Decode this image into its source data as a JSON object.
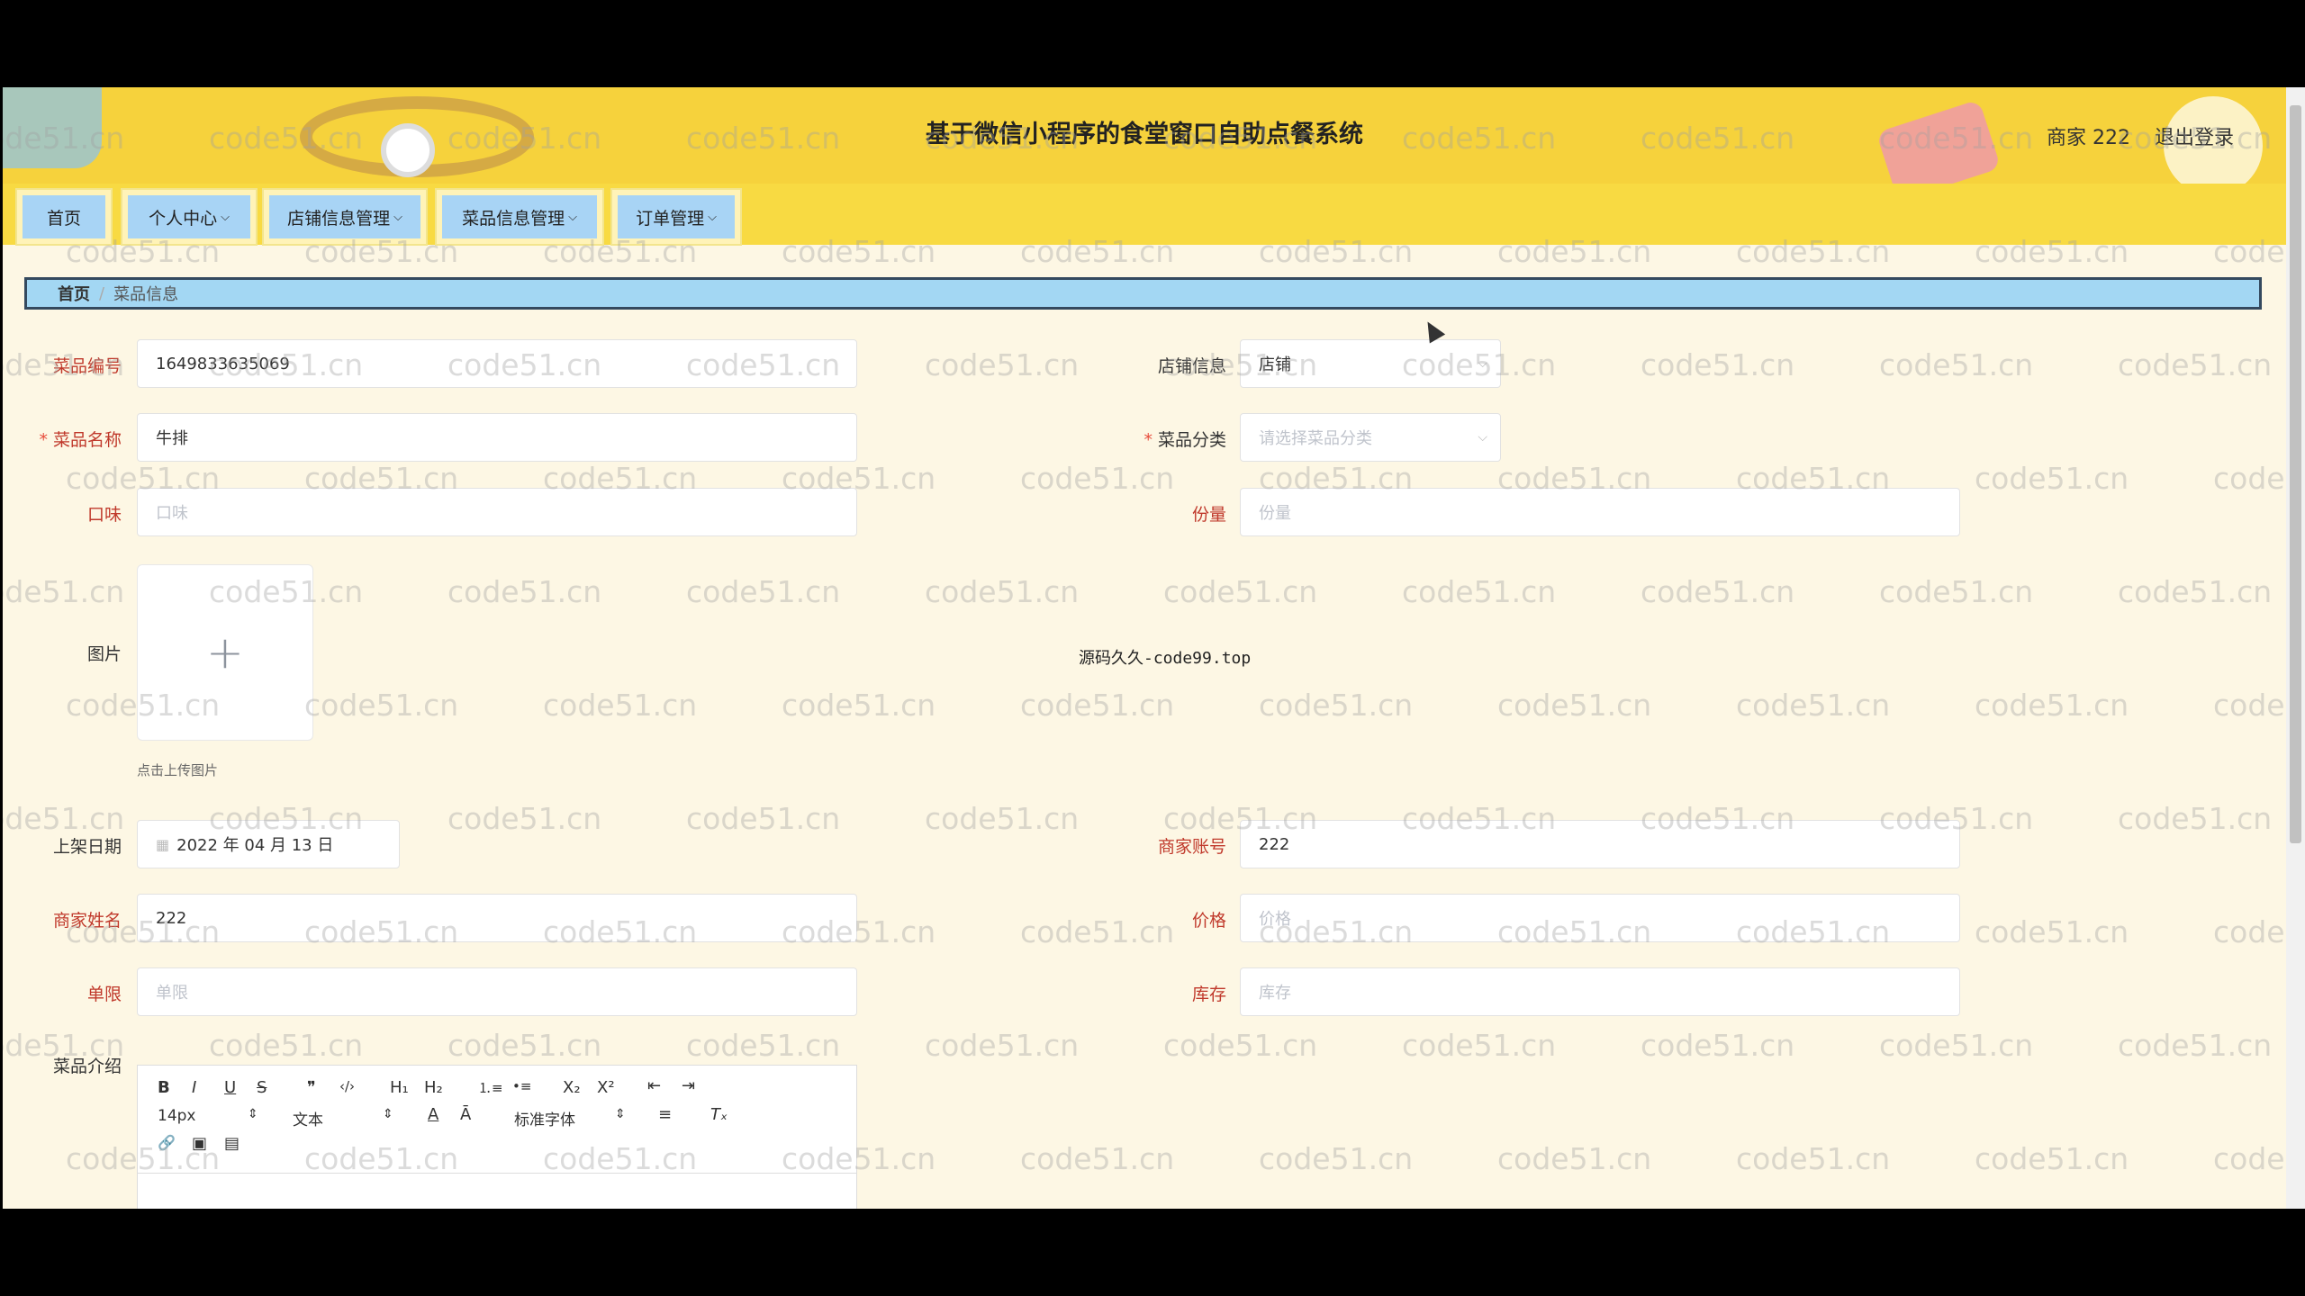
{
  "header": {
    "title": "基于微信小程序的食堂窗口自助点餐系统",
    "user": "商家 222",
    "logout": "退出登录"
  },
  "nav": {
    "items": [
      {
        "label": "首页",
        "dropdown": false
      },
      {
        "label": "个人中心",
        "dropdown": true
      },
      {
        "label": "店铺信息管理",
        "dropdown": true
      },
      {
        "label": "菜品信息管理",
        "dropdown": true
      },
      {
        "label": "订单管理",
        "dropdown": true
      }
    ]
  },
  "breadcrumb": {
    "home": "首页",
    "separator": "/",
    "current": "菜品信息"
  },
  "form": {
    "dish_no": {
      "label": "菜品编号",
      "value": "1649833635069"
    },
    "shop": {
      "label": "店铺信息",
      "value": "店铺"
    },
    "dish_name": {
      "label": "菜品名称",
      "value": "牛排"
    },
    "category": {
      "label": "菜品分类",
      "placeholder": "请选择菜品分类"
    },
    "taste": {
      "label": "口味",
      "placeholder": "口味"
    },
    "portion": {
      "label": "份量",
      "placeholder": "份量"
    },
    "image": {
      "label": "图片",
      "hint": "点击上传图片"
    },
    "shelf_date": {
      "label": "上架日期",
      "value": "2022 年 04 月 13 日"
    },
    "merchant_account": {
      "label": "商家账号",
      "value": "222"
    },
    "merchant_name": {
      "label": "商家姓名",
      "value": "222"
    },
    "price": {
      "label": "价格",
      "placeholder": "价格"
    },
    "limit": {
      "label": "单限",
      "placeholder": "单限"
    },
    "stock": {
      "label": "库存",
      "placeholder": "库存"
    },
    "intro": {
      "label": "菜品介绍"
    }
  },
  "editor": {
    "font_size": "14px",
    "text_type": "文本",
    "font_family": "标准字体",
    "b": "B",
    "i": "I",
    "u": "U",
    "s": "S",
    "quote": "❞",
    "code": "‹/›",
    "h1": "H₁",
    "h2": "H₂",
    "ol": "⒈≡",
    "ul": "•≡",
    "sub": "X₂",
    "sup": "X²",
    "indent_l": "⇤",
    "indent_r": "⇥",
    "color": "A",
    "bg": "Ā",
    "align": "≡",
    "clean": "Tₓ",
    "link": "🔗",
    "img": "▣",
    "video": "▤"
  },
  "overlay_text": "源码久久-code99.top",
  "watermark": "code51.cn",
  "colors": {
    "header": "#f6d23c",
    "nav_btn": "#a8d4f5",
    "breadcrumb": "#a3d7f3",
    "label_red": "#c0392b",
    "background": "#fdf7e4"
  }
}
